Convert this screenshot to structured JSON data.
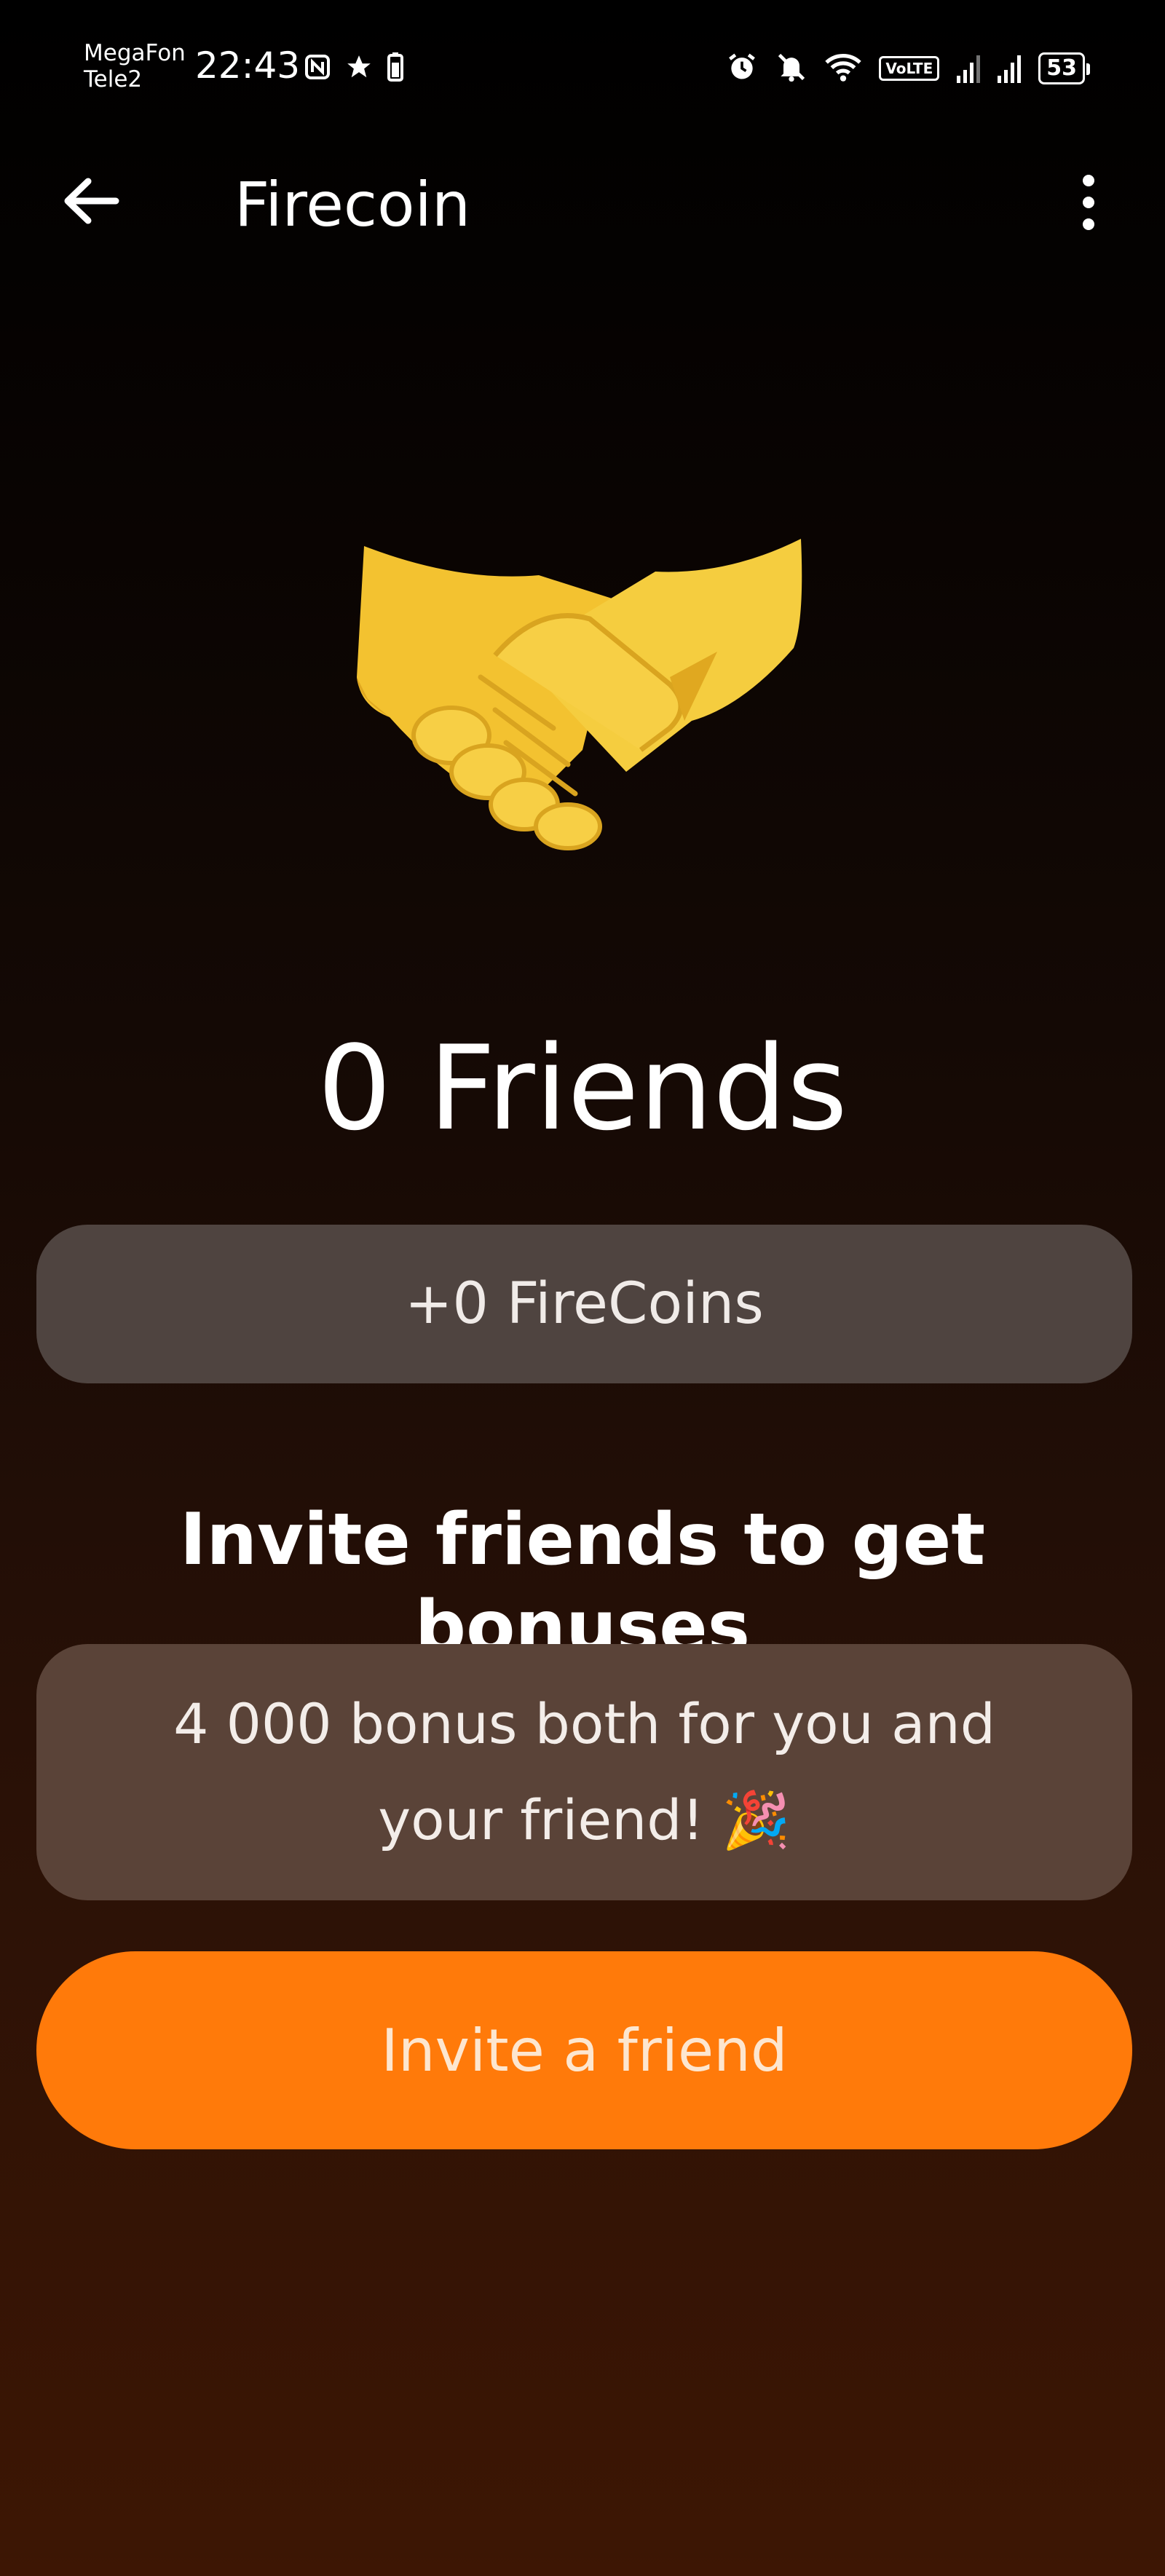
{
  "status_bar": {
    "carrier_1": "MegaFon",
    "carrier_2": "Tele2",
    "time": "22:43",
    "volte": "VoLTE",
    "battery": "53"
  },
  "app_bar": {
    "title": "Firecoin"
  },
  "main": {
    "friends_count": "0 Friends",
    "coins_earned": "+0 FireCoins",
    "invite_heading": "Invite friends to get bonuses",
    "bonus_text": "4 000 bonus both for you and your friend! 🎉",
    "invite_button": "Invite a friend"
  },
  "colors": {
    "accent": "#ff7a0a",
    "pill": "#4f4440",
    "card": "#5a4338"
  }
}
